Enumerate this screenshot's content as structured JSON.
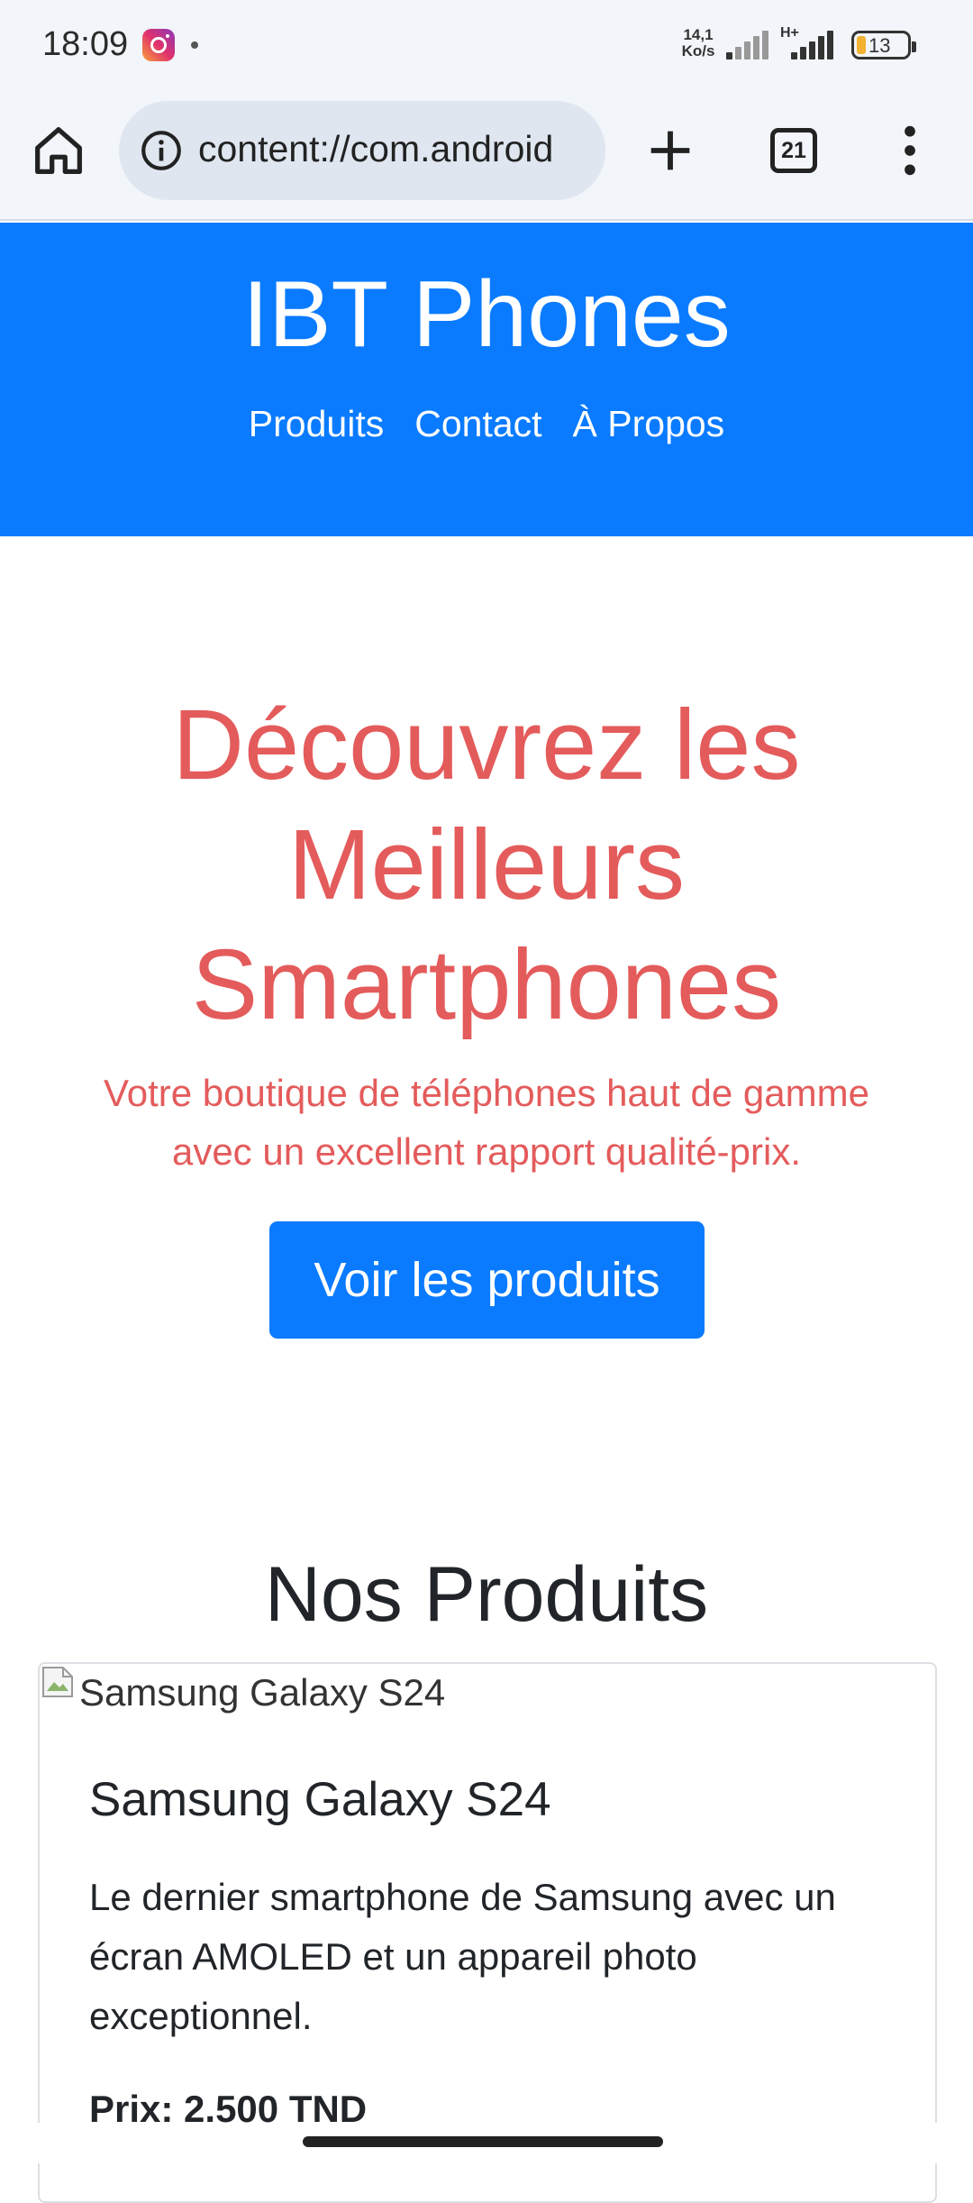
{
  "status_bar": {
    "time": "18:09",
    "net_speed_value": "14,1",
    "net_speed_unit": "Ko/s",
    "network_type": "H+",
    "battery_level": "13",
    "icons": [
      "instagram-icon",
      "signal-icon",
      "signal-icon",
      "battery-icon"
    ]
  },
  "browser": {
    "url": "content://com.android",
    "tab_count": "21",
    "icons": [
      "home-icon",
      "info-icon",
      "plus-icon",
      "tabs-icon",
      "more-vert-icon"
    ]
  },
  "site": {
    "title": "IBT Phones",
    "nav": [
      "Produits",
      "Contact",
      "À Propos"
    ],
    "brand_color": "#0a7bff",
    "accent_color": "#e45b5b"
  },
  "hero": {
    "title_lines": [
      "Découvrez les",
      "Meilleurs",
      "Smartphones"
    ],
    "subtitle_lines": [
      "Votre boutique de téléphones haut de gamme",
      "avec un excellent rapport qualité-prix."
    ],
    "button_label": "Voir les produits"
  },
  "products": {
    "section_title": "Nos Produits",
    "items": [
      {
        "image_alt": "Samsung Galaxy S24",
        "name": "Samsung Galaxy S24",
        "description_lines": [
          "Le dernier smartphone de Samsung avec un",
          "écran AMOLED et un appareil photo",
          "exceptionnel."
        ],
        "price": "Prix: 2.500 TND"
      }
    ]
  }
}
